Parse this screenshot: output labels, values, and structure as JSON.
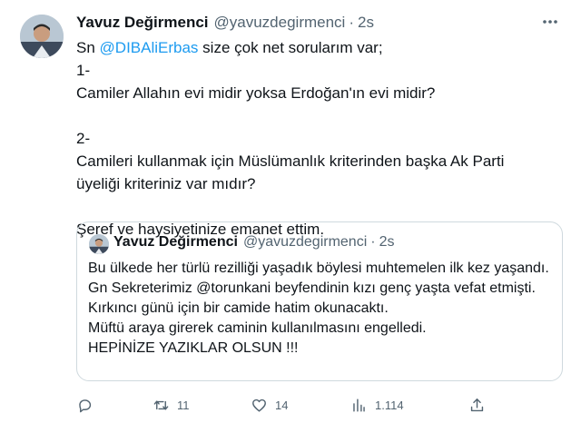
{
  "tweet": {
    "author_name": "Yavuz Değirmenci",
    "author_handle": "@yavuzdegirmenci",
    "separator": "·",
    "time": "2s",
    "line1_prefix": "Sn ",
    "mention": "@DIBAliErbas",
    "line1_suffix": " size çok net sorularım var;",
    "line2": "1-",
    "line3": "Camiler Allahın evi midir yoksa Erdoğan'ın evi midir?",
    "line4": "2-",
    "line5": "Camileri kullanmak için Müslümanlık kriterinden başka Ak Parti üyeliği kriteriniz var mıdır?",
    "line6": "Şeref ve haysiyetinize emanet ettim."
  },
  "quote": {
    "author_name": "Yavuz Değirmenci",
    "author_handle": "@yavuzdegirmenci",
    "separator": "·",
    "time": "2s",
    "lines": [
      "Bu ülkede her türlü rezilliği yaşadık böylesi muhtemelen ilk kez yaşandı.",
      "Gn Sekreterimiz @torunkani beyfendinin kızı genç yaşta vefat etmişti.",
      "Kırkıncı günü için bir camide hatim okunacaktı.",
      "Müftü araya girerek caminin kullanılmasını engelledi.",
      "HEPİNİZE YAZIKLAR OLSUN !!!"
    ]
  },
  "actions": {
    "replies": "",
    "retweets": "11",
    "likes": "14",
    "views": "1.114"
  },
  "icons": {
    "more": "more-icon",
    "reply": "reply-icon",
    "retweet": "retweet-icon",
    "like": "heart-icon",
    "views": "views-icon",
    "share": "share-icon"
  },
  "colors": {
    "mention": "#1d9bf0",
    "secondary_text": "#536471",
    "border": "#cfd9de"
  }
}
